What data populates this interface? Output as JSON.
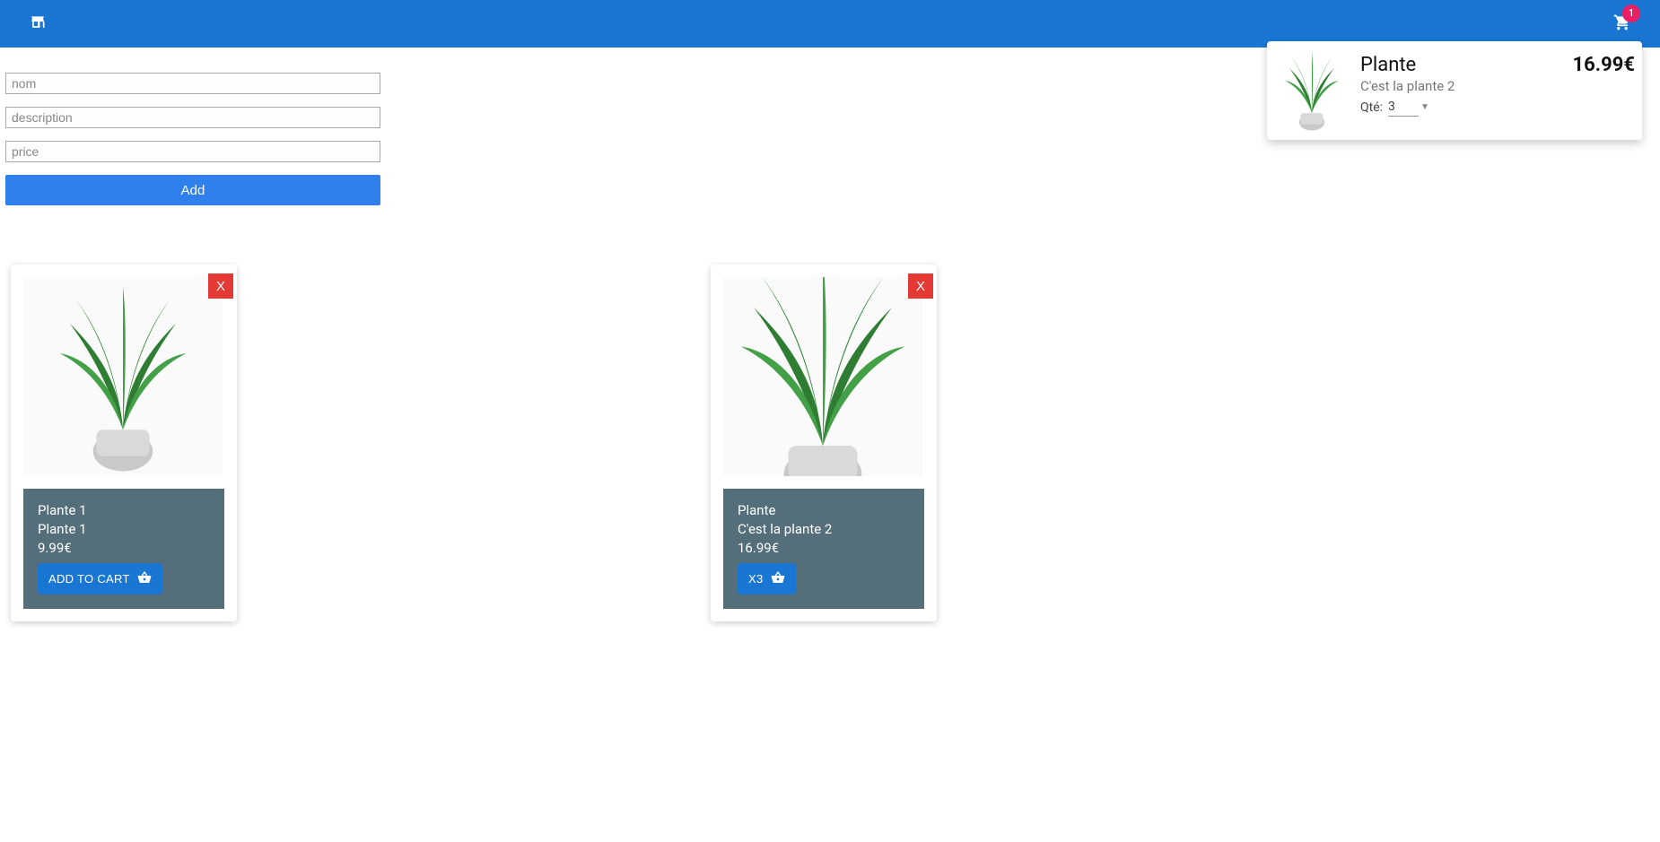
{
  "header": {
    "cart_badge": "1"
  },
  "form": {
    "name_placeholder": "nom",
    "description_placeholder": "description",
    "price_placeholder": "price",
    "add_button": "Add"
  },
  "cart": {
    "items": [
      {
        "title": "Plante",
        "price": "16.99€",
        "description": "C'est la plante 2",
        "qty_label": "Qté:",
        "qty_value": "3"
      }
    ]
  },
  "products": [
    {
      "delete_label": "X",
      "name": "Plante 1",
      "description": "Plante 1",
      "price": "9.99€",
      "button_label": "ADD TO CART"
    },
    {
      "delete_label": "X",
      "name": "Plante",
      "description": "C'est la plante 2",
      "price": "16.99€",
      "button_label": "X3"
    }
  ]
}
